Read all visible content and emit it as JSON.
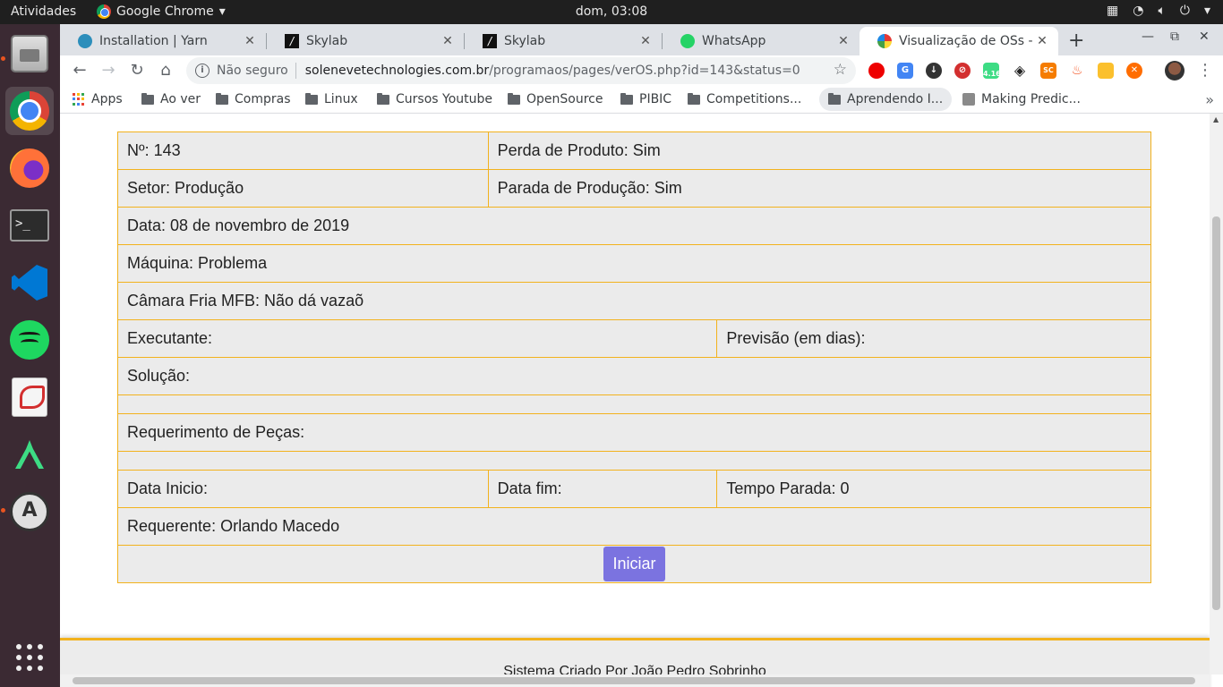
{
  "system": {
    "activities": "Atividades",
    "app_name": "Google Chrome",
    "clock": "dom, 03:08"
  },
  "tabs": [
    {
      "label": "Installation | Yarn",
      "favicon": "yarn-icon"
    },
    {
      "label": "Skylab",
      "favicon": "skylab-icon"
    },
    {
      "label": "Skylab",
      "favicon": "skylab-icon"
    },
    {
      "label": "WhatsApp",
      "favicon": "whatsapp-icon"
    },
    {
      "label": "Visualização de OSs - R",
      "favicon": "os-icon",
      "active": true
    }
  ],
  "address_bar": {
    "security_label": "Não seguro",
    "host": "solenevetechnologies.com.br",
    "path": "/programaos/pages/verOS.php?id=143&status=0"
  },
  "extensions": {
    "badge": "4.16"
  },
  "bookmarks": [
    {
      "label": "Apps"
    },
    {
      "label": "Ao ver"
    },
    {
      "label": "Compras"
    },
    {
      "label": "Linux"
    },
    {
      "label": "Cursos Youtube"
    },
    {
      "label": "OpenSource"
    },
    {
      "label": "PIBIC"
    },
    {
      "label": "Competitions..."
    },
    {
      "label": "Aprendendo I..."
    },
    {
      "label": "Making Predic..."
    }
  ],
  "os": {
    "numero": "Nº: 143",
    "perda_produto": "Perda de Produto: Sim",
    "setor": "Setor: Produção",
    "parada_producao": "Parada de Produção: Sim",
    "data": "Data: 08 de novembro de 2019",
    "maquina": "Máquina: Problema",
    "camara": "Câmara Fria MFB: Não dá vazaõ",
    "executante": "Executante:",
    "previsao": "Previsão (em dias):",
    "solucao": "Solução:",
    "requerimento_pecas": "Requerimento de Peças:",
    "data_inicio": "Data Inicio:",
    "data_fim": "Data fim:",
    "tempo_parada": "Tempo Parada: 0",
    "requerente": "Requerente: Orlando Macedo",
    "iniciar_label": "Iniciar"
  },
  "footer": {
    "credit": "Sistema Criado Por João Pedro Sobrinho"
  },
  "colors": {
    "table_border": "#f2b21d",
    "cell_bg": "#ebebeb",
    "button_bg": "#7b73e0"
  }
}
